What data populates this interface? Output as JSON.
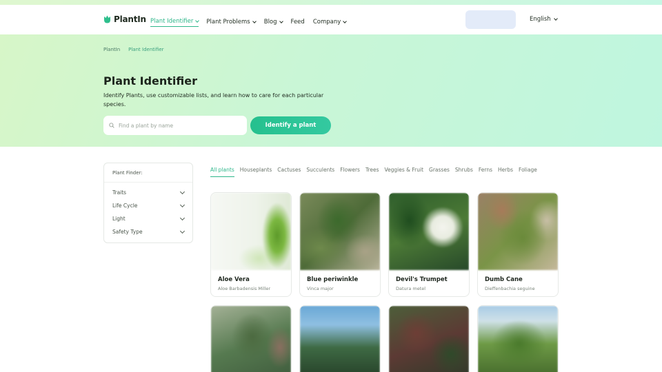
{
  "header": {
    "logo_text": "PlantIn",
    "nav": [
      {
        "label": "Plant Identifier",
        "active": true,
        "dropdown": true
      },
      {
        "label": "Plant Problems",
        "active": false,
        "dropdown": true
      },
      {
        "label": "Blog",
        "active": false,
        "dropdown": true
      },
      {
        "label": "Feed",
        "active": false,
        "dropdown": false
      },
      {
        "label": "Company",
        "active": false,
        "dropdown": true
      }
    ],
    "language": "English"
  },
  "breadcrumb": [
    "PlantIn",
    "Plant Identifier"
  ],
  "hero": {
    "title": "Plant Identifier",
    "description": "Identify Plants, use customizable lists, and learn how to care for each particular species.",
    "search_placeholder": "Find a plant by name",
    "identify_button": "Identify a plant"
  },
  "finder": {
    "title": "Plant Finder:",
    "items": [
      "Traits",
      "Life Cycle",
      "Light",
      "Safety Type"
    ]
  },
  "filters": [
    "All plants",
    "Houseplants",
    "Cactuses",
    "Succulents",
    "Flowers",
    "Trees",
    "Veggies & Fruit",
    "Grasses",
    "Shrubs",
    "Ferns",
    "Herbs",
    "Foliage"
  ],
  "active_filter": "All plants",
  "plants": [
    {
      "name": "Aloe Vera",
      "scientific": "Aloe Barbadensis Miller"
    },
    {
      "name": "Blue periwinkle",
      "scientific": "Vinca major"
    },
    {
      "name": "Devil's Trumpet",
      "scientific": "Datura metel"
    },
    {
      "name": "Dumb Cane",
      "scientific": "Dieffenbachia seguine"
    }
  ],
  "colors": {
    "accent": "#2db68a",
    "button_gradient_start": "#25c08e",
    "button_gradient_end": "#34c9a0"
  },
  "icons": {
    "logo": "tulip-icon",
    "search": "search-icon",
    "dropdown": "chevron-down-icon"
  }
}
